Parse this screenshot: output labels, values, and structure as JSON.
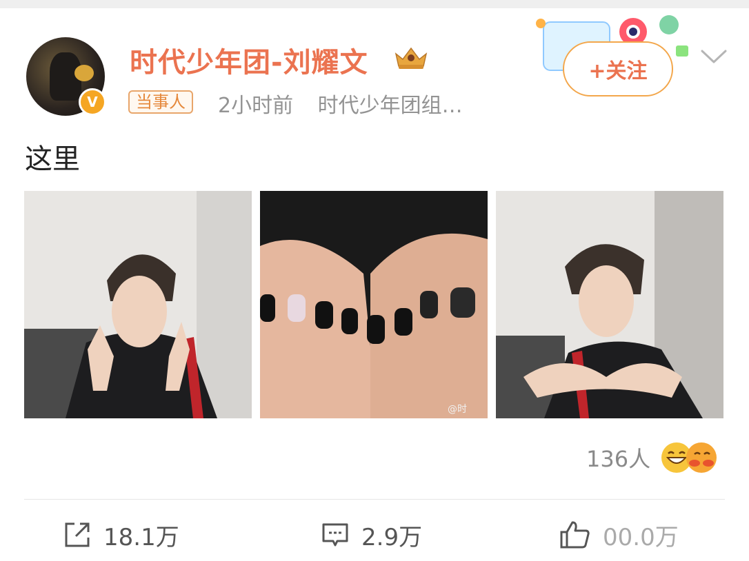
{
  "post": {
    "author": {
      "name": "时代少年团-刘耀文",
      "verified": true,
      "tag": "当事人"
    },
    "time": "2小时前",
    "source": "时代少年团组…",
    "follow_label": "+关注",
    "text": "这里",
    "photos": [
      {
        "alt": "photo of person showing painted nails"
      },
      {
        "alt": "close-up of black and white nail art",
        "watermark": "@时"
      },
      {
        "alt": "photo of person posing with hands"
      }
    ],
    "reactions_count": "136人",
    "actions": {
      "repost": "18.1万",
      "comment": "2.9万",
      "like": "00.0万"
    }
  },
  "icons": [
    "crown-icon",
    "verified-badge-icon",
    "chevron-down-icon",
    "repost-icon",
    "comment-icon",
    "like-icon",
    "grin-emoji-icon",
    "hug-emoji-icon"
  ],
  "colors": {
    "username": "#eb7350",
    "tag_border": "#e8a56a",
    "follow_border": "#f3a64a",
    "badge": "#f5a623"
  }
}
